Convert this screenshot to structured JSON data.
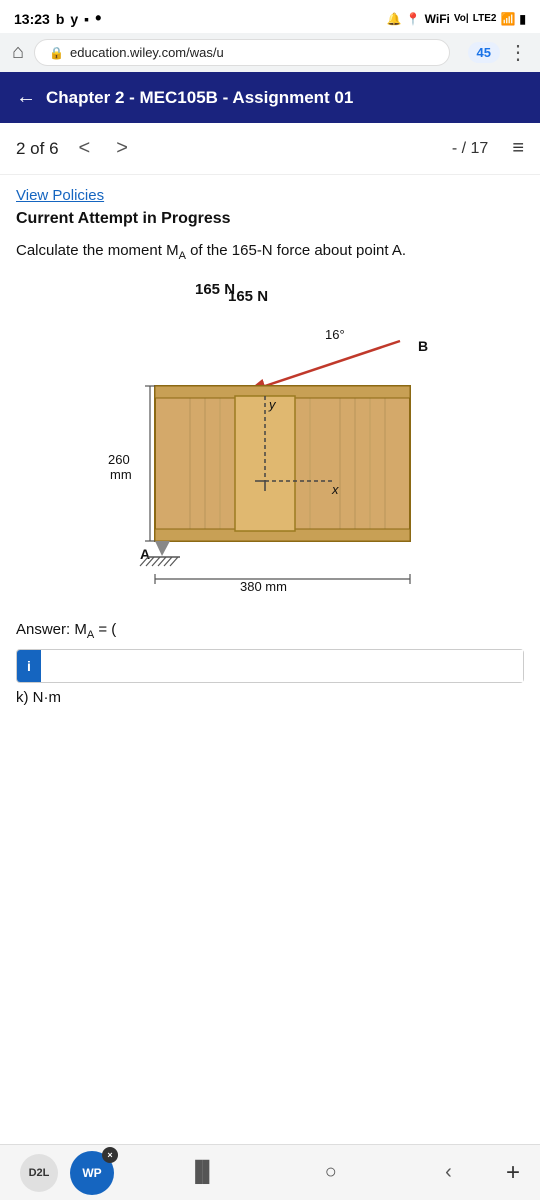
{
  "status_bar": {
    "time": "13:23",
    "icons_left": [
      "b",
      "y",
      "screen"
    ],
    "icons_right": [
      "bell",
      "wifi",
      "vol",
      "lte2",
      "signal",
      "battery"
    ]
  },
  "browser": {
    "url": "education.wiley.com/was/u",
    "badge": "45"
  },
  "header": {
    "back_label": "←",
    "title": "Chapter 2 - MEC105B - Assignment 01"
  },
  "navigation": {
    "count": "2 of 6",
    "prev": "<",
    "next": ">",
    "score": "- / 17"
  },
  "view_policies": "View Policies",
  "attempt_label": "Current Attempt in Progress",
  "question": {
    "text_1": "Calculate the moment M",
    "subscript_A": "A",
    "text_2": " of the 165-N force about point A."
  },
  "diagram": {
    "force_value": "165 N",
    "angle_label": "16°",
    "point_B": "B",
    "dimension_height": "260",
    "dimension_height_unit": "mm",
    "dimension_width": "380 mm",
    "axis_x": "x",
    "axis_y": "y",
    "point_A": "A"
  },
  "answer": {
    "prefix": "Answer: M",
    "subscript": "A",
    "equals": "= (",
    "info_btn": "i",
    "placeholder": "",
    "unit": "k) N·m"
  },
  "bottom_bar": {
    "d2l_label": "D2L",
    "wp_label": "WP",
    "close_x": "×",
    "nav_icons": [
      "||",
      "○",
      "<"
    ],
    "plus": "+"
  }
}
